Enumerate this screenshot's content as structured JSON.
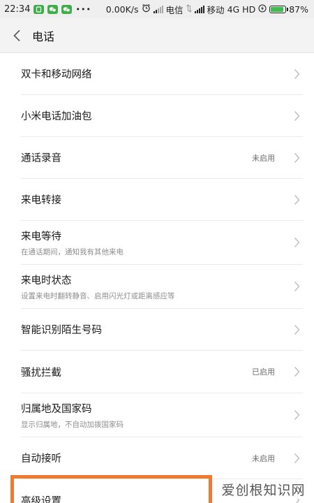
{
  "status_bar": {
    "time": "22:34",
    "dots": "•••",
    "speed": "0.00K/s",
    "carrier1": "电信",
    "carrier2": "移动",
    "network": "4G HD",
    "battery_percent": "87%",
    "battery_level": 0.87
  },
  "header": {
    "title": "电话",
    "back_icon": "chevron-left-icon"
  },
  "items": [
    {
      "label": "双卡和移动网络",
      "sub": "",
      "status": ""
    },
    {
      "label": "小米电话加油包",
      "sub": "",
      "status": ""
    },
    {
      "label": "通话录音",
      "sub": "",
      "status": "未启用"
    },
    {
      "label": "来电转接",
      "sub": "",
      "status": ""
    },
    {
      "label": "来电等待",
      "sub": "在通话期间，通知我有其他来电",
      "status": ""
    },
    {
      "label": "来电时状态",
      "sub": "设置来电时翻转静音、启用闪光灯或距离感应等",
      "status": ""
    },
    {
      "label": "智能识别陌生号码",
      "sub": "",
      "status": ""
    },
    {
      "label": "骚扰拦截",
      "sub": "",
      "status": "已启用"
    },
    {
      "label": "归属地及国家码",
      "sub": "显示归属地，不自动加拨国家码",
      "status": ""
    },
    {
      "label": "自动接听",
      "sub": "",
      "status": "未启用"
    },
    {
      "label": "高级设置",
      "sub": "",
      "status": ""
    }
  ],
  "watermark": "爱创根知识网",
  "colors": {
    "highlight": "#f07a30",
    "battery": "#3fbb4f",
    "status_bar_bg": "#efefef",
    "header_bg": "#f3f3f3"
  }
}
